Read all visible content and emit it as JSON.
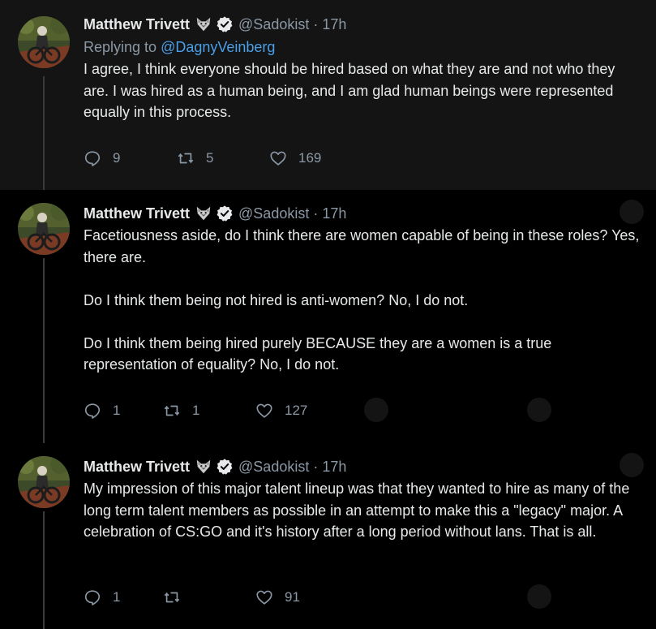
{
  "colors": {
    "accent": "#4a9fe8",
    "muted": "#8b98a5",
    "text": "#e7e9ea",
    "highlight_bg": "#141414"
  },
  "tweets": [
    {
      "name": "Matthew Trivett",
      "handle": "@Sadokist",
      "dot": "·",
      "time": "17h",
      "reply_prefix": "Replying to ",
      "reply_to": "@DagnyVeinberg",
      "body": [
        "I agree, I think everyone should be hired based on what they are and not who they are. I was hired as a human being, and I am glad human beings were represented equally in this process."
      ],
      "replies": "9",
      "retweets": "5",
      "likes": "169"
    },
    {
      "name": "Matthew Trivett",
      "handle": "@Sadokist",
      "dot": "·",
      "time": "17h",
      "body": [
        "Facetiousness aside, do I think there are women capable of being in these roles? Yes, there are.",
        "Do I think them being not hired is anti-women? No, I do not.",
        "Do I think them being hired purely BECAUSE they are a women is a true representation of equality? No, I do not."
      ],
      "replies": "1",
      "retweets": "1",
      "likes": "127"
    },
    {
      "name": "Matthew Trivett",
      "handle": "@Sadokist",
      "dot": "·",
      "time": "17h",
      "body": [
        "My impression of this major talent lineup was that they wanted to hire as many of the long term talent members as possible in an attempt to make this a \"legacy\" major. A celebration of CS:GO and it's history after a long period without lans. That is all."
      ],
      "replies": "1",
      "retweets": "",
      "likes": "91"
    }
  ]
}
